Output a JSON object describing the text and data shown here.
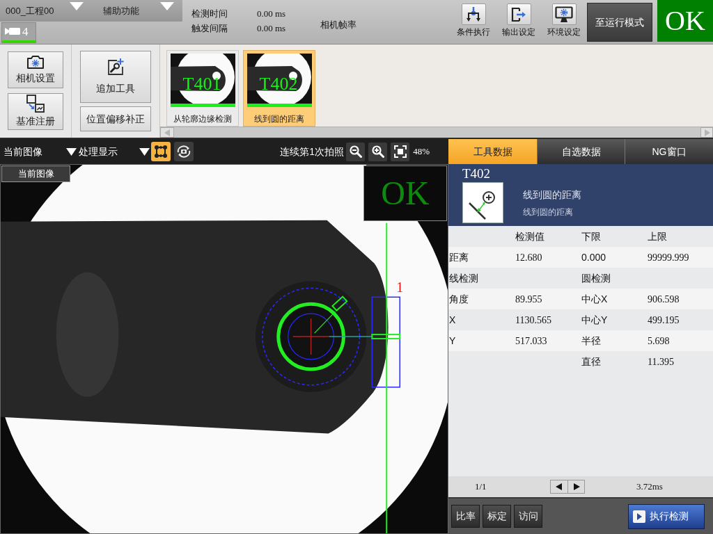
{
  "header": {
    "project": "000_工程00",
    "menu": "辅助功能",
    "camera_tab": {
      "label": "4"
    },
    "timing": [
      {
        "label": "检测时间",
        "value": "0.00 ms"
      },
      {
        "label": "触发间隔",
        "value": "0.00 ms"
      }
    ],
    "frame_rate_label": "相机帧率",
    "tools": [
      {
        "kind": "branch",
        "label": "条件执行"
      },
      {
        "kind": "output",
        "label": "输出设定"
      },
      {
        "kind": "monitor",
        "label": "环境设定"
      }
    ],
    "run_mode_button": "至运行模式",
    "judgement": {
      "kind": "ok",
      "label": "OK"
    }
  },
  "setup_buttons": [
    {
      "kind": "camera",
      "label": "相机设置"
    },
    {
      "kind": "register",
      "label": "基准注册"
    }
  ],
  "tool_buttons": [
    {
      "kind": "add",
      "label": "追加工具"
    },
    {
      "kind": "offset",
      "label": "位置偏移补正"
    }
  ],
  "tool_list": [
    {
      "overlay": "T401",
      "name": "从轮廓边缘检测",
      "selected": false
    },
    {
      "overlay": "T402",
      "name": "线到圆的距离",
      "selected": true
    }
  ],
  "image_toolbar": {
    "source": "当前图像",
    "display": "处理显示",
    "toggles": [
      {
        "kind": "roi",
        "on": true
      },
      {
        "kind": "camera",
        "on": false
      }
    ],
    "capture_info": "连续第1次拍照",
    "zoom": "48%"
  },
  "view": {
    "tag": "当前图像",
    "region_label": "1",
    "judgement": {
      "kind": "ok",
      "label": "OK"
    }
  },
  "tabs": [
    {
      "label": "工具数据",
      "selected": true
    },
    {
      "label": "自选数据",
      "selected": false
    },
    {
      "label": "NG窗口",
      "selected": false
    }
  ],
  "tool_info": {
    "id": "T402",
    "title": "线到圆的距离",
    "subtitle": "线到圆的距离"
  },
  "table": {
    "header": {
      "column_2": "检测值",
      "column_3": "下限",
      "column_4": "上限"
    },
    "rows": [
      {
        "column_1": "距离",
        "column_2": "12.680",
        "column_3": "0.000",
        "column_4": "99999.999"
      },
      {
        "column_1": "线检测",
        "column_3": "圆检测"
      },
      {
        "column_1": "角度",
        "column_2": "89.955",
        "column_3": "中心X",
        "column_4": "906.598"
      },
      {
        "column_1": "X",
        "column_2": "1130.565",
        "column_3": "中心Y",
        "column_4": "499.195"
      },
      {
        "column_1": "Y",
        "column_2": "517.033",
        "column_3": "半径",
        "column_4": "5.698"
      },
      {
        "column_3": "直径",
        "column_4": "11.395"
      }
    ]
  },
  "footer": {
    "page": "1/1",
    "time": "3.72ms"
  },
  "bottom_buttons": [
    "比率",
    "标定",
    "访问"
  ],
  "run_button": "执行检测"
}
